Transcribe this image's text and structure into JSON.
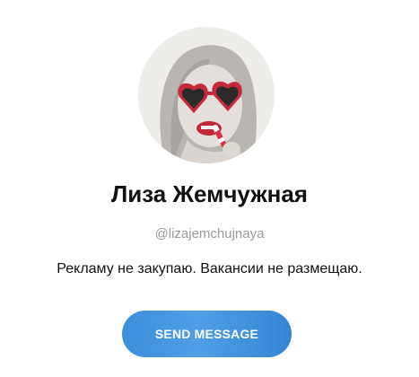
{
  "profile": {
    "name": "Лиза Жемчужная",
    "username": "@lizajemchujnaya",
    "bio": "Рекламу не закупаю. Вакансии не размещаю.",
    "send_button_label": "SEND MESSAGE"
  },
  "colors": {
    "button_accent": "#4a9be3",
    "username_gray": "#9a9a9a",
    "text_dark": "#111111"
  }
}
